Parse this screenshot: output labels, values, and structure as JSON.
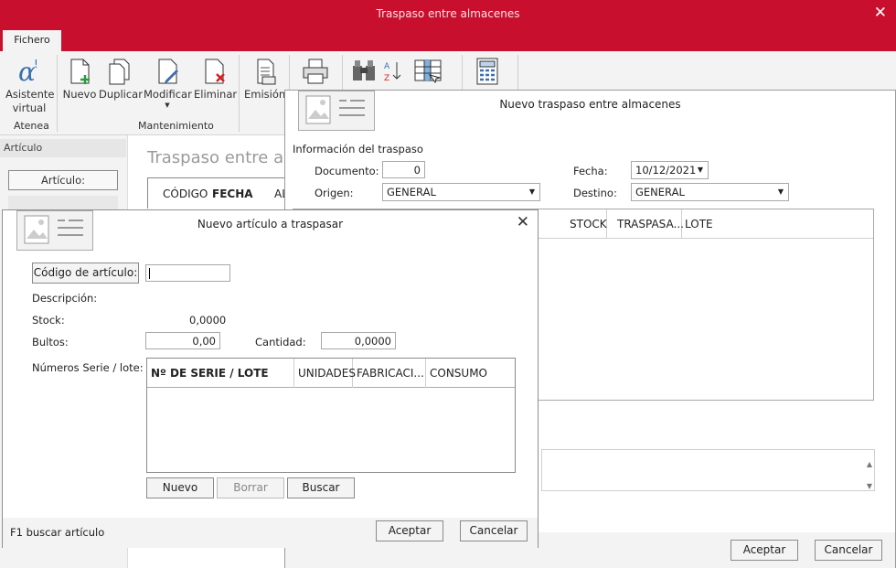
{
  "window": {
    "title": "Traspaso entre almacenes"
  },
  "ribbon": {
    "tab": "Fichero",
    "buttons": {
      "asistente": "Asistente\nvirtual",
      "nuevo": "Nuevo",
      "duplicar": "Duplicar",
      "modificar": "Modificar",
      "eliminar": "Eliminar",
      "emision": "Emisión"
    },
    "groups": {
      "atenea": "Atenea",
      "mantenimiento": "Mantenimiento"
    }
  },
  "left_pane": {
    "header": "Artículo",
    "button": "Artículo:"
  },
  "background": {
    "heading": "Traspaso entre alm",
    "columns": [
      "CÓDIGO",
      "FECHA",
      "AL"
    ]
  },
  "dialog_transfer": {
    "title": "Nuevo traspaso entre almacenes",
    "section": "Información del traspaso",
    "documento_label": "Documento:",
    "documento_value": "0",
    "fecha_label": "Fecha:",
    "fecha_value": "10/12/2021",
    "origen_label": "Origen:",
    "origen_value": "GENERAL",
    "destino_label": "Destino:",
    "destino_value": "GENERAL",
    "columns": [
      "STOCK",
      "TRASPASA...",
      "LOTE"
    ],
    "accept": "Aceptar",
    "cancel": "Cancelar"
  },
  "dialog_article": {
    "title": "Nuevo artículo a traspasar",
    "codigo_button": "Código de artículo:",
    "codigo_value": "",
    "descripcion_label": "Descripción:",
    "stock_label": "Stock:",
    "stock_value": "0,0000",
    "bultos_label": "Bultos:",
    "bultos_value": "0,00",
    "cantidad_label": "Cantidad:",
    "cantidad_value": "0,0000",
    "series_label": "Números Serie / lote:",
    "columns": [
      "Nº DE SERIE / LOTE",
      "UNIDADES",
      "FABRICACI...",
      "CONSUMO"
    ],
    "nuevo": "Nuevo",
    "borrar": "Borrar",
    "buscar": "Buscar",
    "hint": "F1 buscar artículo",
    "accept": "Aceptar",
    "cancel": "Cancelar"
  },
  "colors": {
    "accent": "#c8102e",
    "ribbon_bg": "#f3f3f3"
  }
}
